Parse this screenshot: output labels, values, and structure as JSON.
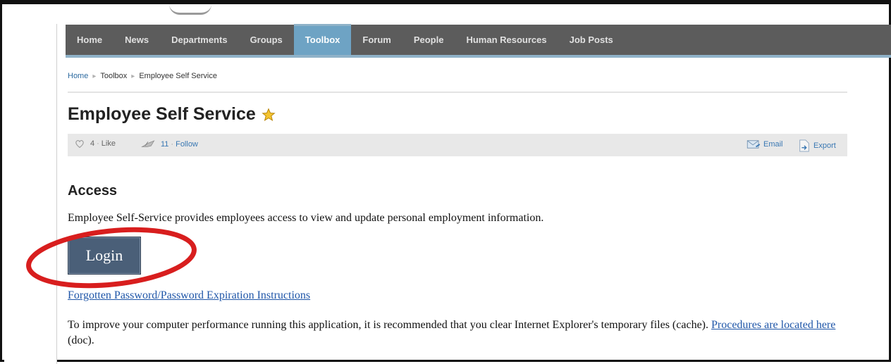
{
  "nav": {
    "items": [
      {
        "label": "Home",
        "active": false
      },
      {
        "label": "News",
        "active": false
      },
      {
        "label": "Departments",
        "active": false
      },
      {
        "label": "Groups",
        "active": false
      },
      {
        "label": "Toolbox",
        "active": true
      },
      {
        "label": "Forum",
        "active": false
      },
      {
        "label": "People",
        "active": false
      },
      {
        "label": "Human Resources",
        "active": false
      },
      {
        "label": "Job Posts",
        "active": false
      }
    ]
  },
  "breadcrumb": [
    "Home",
    "Toolbox",
    "Employee Self Service"
  ],
  "page": {
    "title": "Employee Self Service",
    "actions": {
      "like_count": "4",
      "like_label": "Like",
      "follow_count": "11",
      "follow_label": "Follow",
      "email_label": "Email",
      "export_label": "Export"
    }
  },
  "access": {
    "heading": "Access",
    "description": "Employee Self-Service provides employees access to view and update personal employment information.",
    "login_label": "Login",
    "forgot_link": "Forgotten Password/Password Expiration Instructions",
    "perf_text_1": "To improve your computer performance running this application, it is recommended that you clear Internet Explorer's temporary files (cache). ",
    "perf_link": "Procedures are located here",
    "perf_text_2": " (doc)."
  },
  "colors": {
    "nav_bg": "#5c5c5c",
    "nav_active": "#6ea3c4",
    "login_bg": "#4a5f78",
    "highlight_ring": "#d81e1e",
    "link": "#1f56a8"
  },
  "icons": {
    "favorite": "star-icon",
    "like": "heart-icon",
    "follow": "follow-icon",
    "email": "email-icon",
    "export": "export-icon"
  }
}
